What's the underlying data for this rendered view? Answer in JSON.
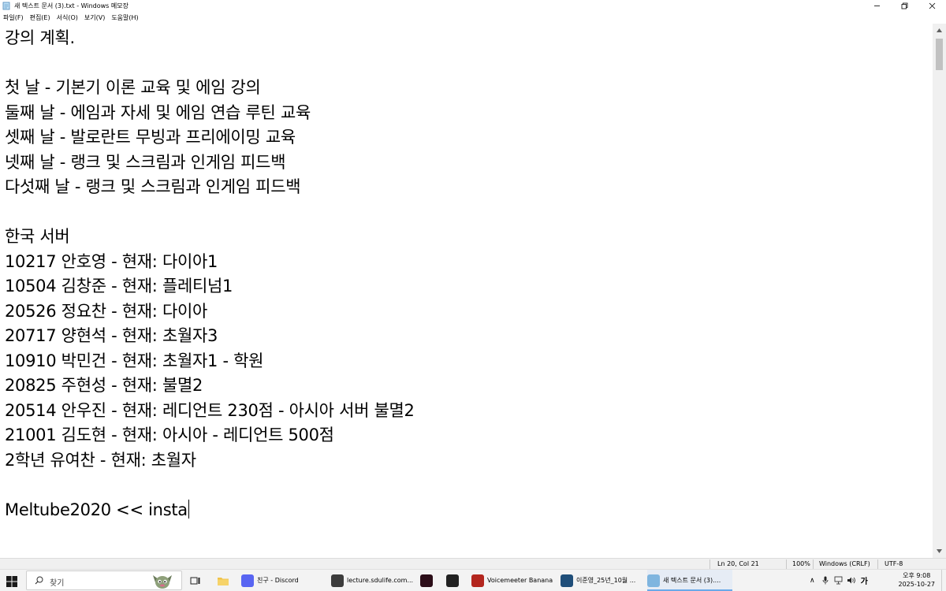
{
  "window": {
    "title": "새 텍스트 문서 (3).txt - Windows 메모장",
    "minimize_label": "",
    "maximize_label": "",
    "close_label": ""
  },
  "menu": [
    "파일(F)",
    "편집(E)",
    "서식(O)",
    "보기(V)",
    "도움말(H)"
  ],
  "editor": {
    "lines": [
      "강의 계획.",
      "",
      "첫 날 - 기본기 이론 교육 및 에임 강의",
      "둘째 날 - 에임과 자세 및 에임 연습 루틴 교육",
      "셋째 날 - 발로란트 무빙과 프리에이밍 교육",
      "넷째 날 - 랭크 및 스크림과 인게임 피드백",
      "다섯째 날 - 랭크 및 스크림과 인게임 피드백",
      "",
      "한국 서버",
      "10217 안호영 - 현재: 다이아1",
      "10504 김창준 - 현재: 플레티넘1",
      "20526 정요찬 - 현재: 다이아",
      "20717 양현석 - 현재: 초월자3",
      "10910 박민건 - 현재: 초월자1 - 학원",
      "20825 주현성 - 현재: 불멸2",
      "20514 안우진 - 현재: 레디언트 230점 - 아시아 서버 불멸2",
      "21001 김도현 - 현재: 아시아 - 레디언트 500점",
      "2학년 유여찬 - 현재: 초월자",
      "",
      "Meltube2020 << insta"
    ]
  },
  "statusbar": {
    "position": "Ln 20, Col 21",
    "zoom": "100%",
    "line_ending": "Windows (CRLF)",
    "encoding": "UTF-8"
  },
  "taskbar": {
    "search_label": "찾기",
    "items": [
      {
        "label": "친구 - Discord",
        "color": "#5865f2",
        "icon": "discord-icon"
      },
      {
        "label": "lecture.sdulife.com...",
        "color": "#3c3c3c",
        "icon": "browser-icon"
      },
      {
        "label": "",
        "color": "#2b0d18",
        "icon": "valorant-icon"
      },
      {
        "label": "",
        "color": "#222222",
        "icon": "obs-icon"
      },
      {
        "label": "Voicemeeter Banana",
        "color": "#b3261e",
        "icon": "voicemeeter-icon"
      },
      {
        "label": "이준영_25년_10월 ...",
        "color": "#1f4e79",
        "icon": "document-icon"
      },
      {
        "label": "새 텍스트 문서 (3)....",
        "color": "#7fb5df",
        "icon": "notepad-icon"
      }
    ],
    "ime": "가",
    "clock": {
      "line1": "오후 9:08",
      "line2": "2025-10-27"
    }
  },
  "colors": {
    "accent": "#6aa9e9",
    "statusbar_bg": "#f0f0f0",
    "taskbar_bg": "#f3f3f3"
  }
}
